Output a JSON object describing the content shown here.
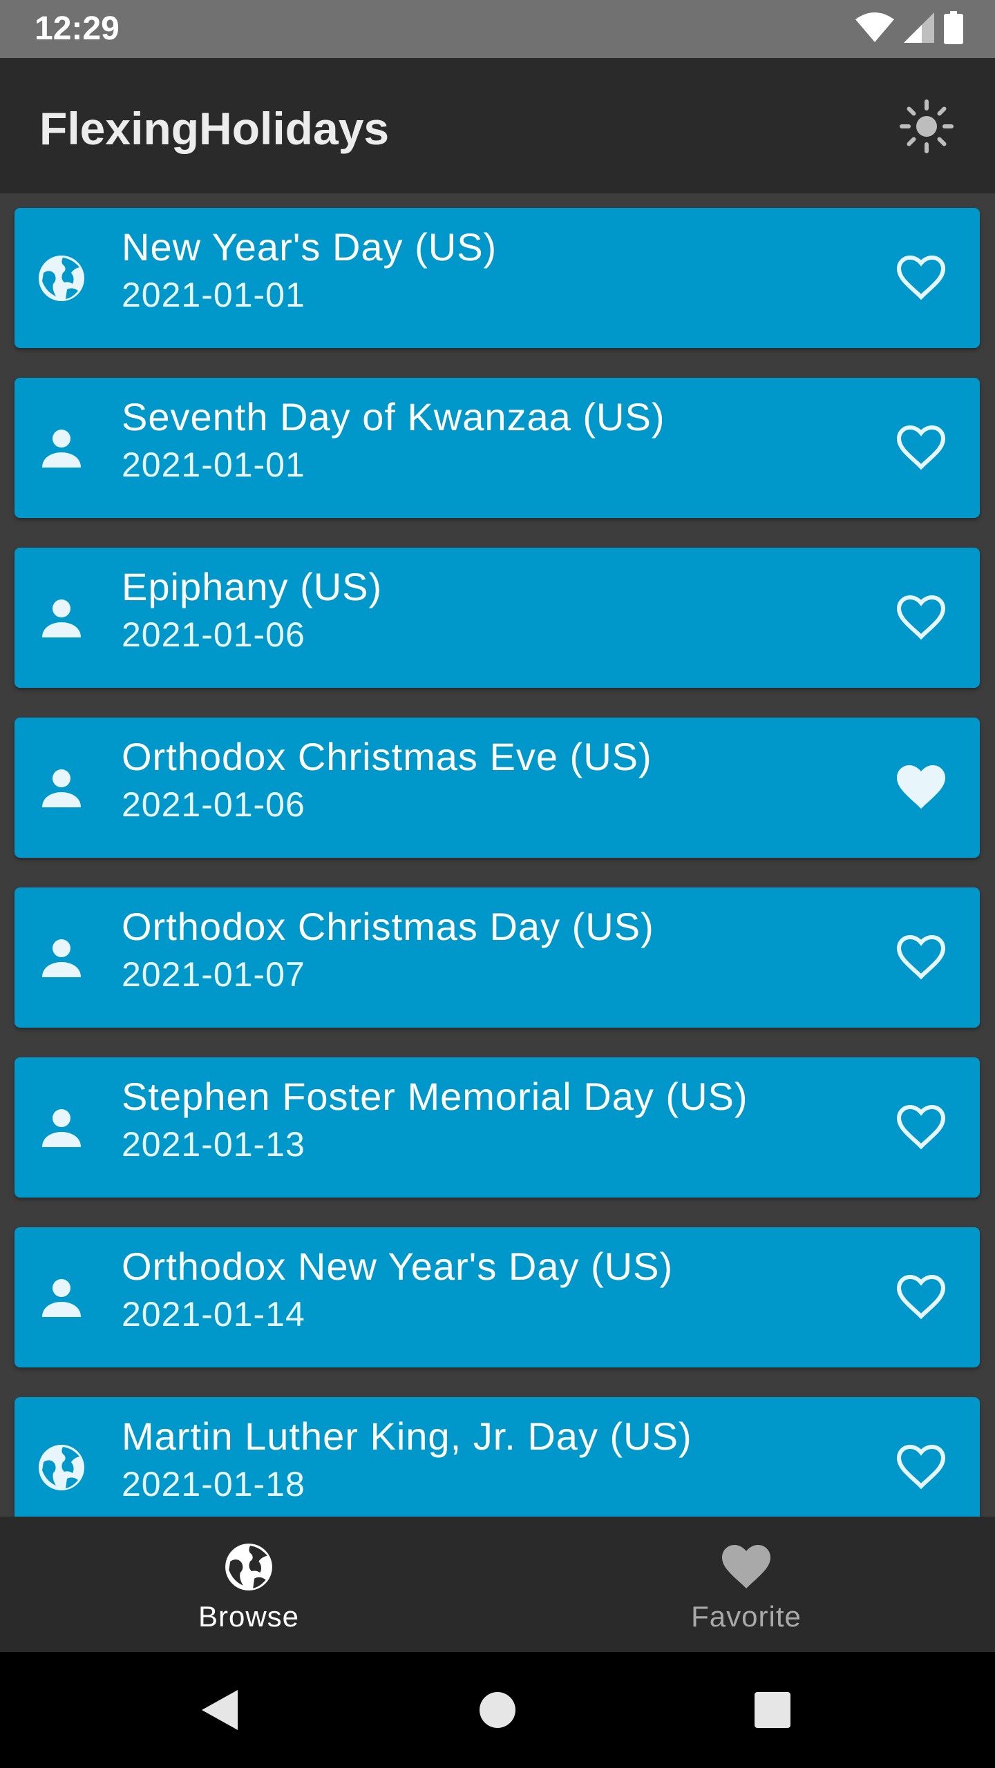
{
  "status_bar": {
    "time": "12:29",
    "icons": [
      "wifi-icon",
      "signal-icon",
      "battery-icon"
    ]
  },
  "app_bar": {
    "title": "FlexingHolidays",
    "action_icon": "brightness-icon"
  },
  "colors": {
    "card_background": "#0097cb",
    "app_bar": "#2a2a2b",
    "list_background": "#3d3d3d",
    "status_bar": "#717171"
  },
  "holidays": [
    {
      "name": "New Year's Day (US)",
      "date": "2021-01-01",
      "type_icon": "globe-icon",
      "favorite": false
    },
    {
      "name": "Seventh Day of Kwanzaa (US)",
      "date": "2021-01-01",
      "type_icon": "person-icon",
      "favorite": false
    },
    {
      "name": "Epiphany (US)",
      "date": "2021-01-06",
      "type_icon": "person-icon",
      "favorite": false
    },
    {
      "name": "Orthodox Christmas Eve (US)",
      "date": "2021-01-06",
      "type_icon": "person-icon",
      "favorite": true
    },
    {
      "name": "Orthodox Christmas Day (US)",
      "date": "2021-01-07",
      "type_icon": "person-icon",
      "favorite": false
    },
    {
      "name": "Stephen Foster Memorial Day (US)",
      "date": "2021-01-13",
      "type_icon": "person-icon",
      "favorite": false
    },
    {
      "name": "Orthodox New Year's Day (US)",
      "date": "2021-01-14",
      "type_icon": "person-icon",
      "favorite": false
    },
    {
      "name": "Martin Luther King, Jr. Day (US)",
      "date": "2021-01-18",
      "type_icon": "globe-icon",
      "favorite": false
    }
  ],
  "bottom_nav": {
    "tabs": [
      {
        "label": "Browse",
        "icon": "globe-icon",
        "active": true
      },
      {
        "label": "Favorite",
        "icon": "heart-icon",
        "active": false
      }
    ]
  },
  "system_nav": {
    "buttons": [
      "back-icon",
      "home-icon",
      "recents-icon"
    ]
  }
}
